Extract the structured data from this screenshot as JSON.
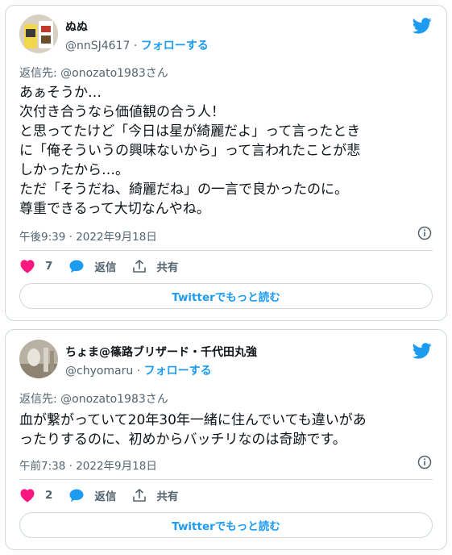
{
  "tweets": [
    {
      "display_name": "ぬぬ",
      "handle": "@nnSJ4617",
      "separator": " · ",
      "follow_label": "フォローする",
      "reply_to": "返信先: @onozato1983さん",
      "lines": [
        "あぁそうか…",
        "次付き合うなら価値観の合う人！",
        "と思ってたけど「今日は星が綺麗だよ」って言ったとき",
        "に「俺そういうの興味ないから」って言われたことが悲",
        "しかったから…。",
        "ただ「そうだね、綺麗だね」の一言で良かったのに。",
        "尊重できるって大切なんやね。"
      ],
      "timestamp": "午後9:39 · 2022年9月18日",
      "like_count": "7",
      "reply_label": "返信",
      "share_label": "共有",
      "more_label": "Twitterでもっと読む"
    },
    {
      "display_name": "ちょま@篠路ブリザード・千代田丸強",
      "handle": "@chyomaru",
      "separator": " · ",
      "follow_label": "フォローする",
      "reply_to": "返信先: @onozato1983さん",
      "lines": [
        "血が繋がっていて20年30年一緒に住んでいても違いがあ",
        "ったりするのに、初めからバッチリなのは奇跡です。"
      ],
      "timestamp": "午前7:38 · 2022年9月18日",
      "like_count": "2",
      "reply_label": "返信",
      "share_label": "共有",
      "more_label": "Twitterでもっと読む"
    }
  ],
  "colors": {
    "accent": "#1d9bf0",
    "like": "#f91880",
    "text": "#0f1419",
    "muted": "#536471",
    "border": "#cfd9de"
  },
  "icons": [
    "twitter-bird-icon",
    "info-icon",
    "heart-icon",
    "reply-bubble-icon",
    "share-icon"
  ]
}
